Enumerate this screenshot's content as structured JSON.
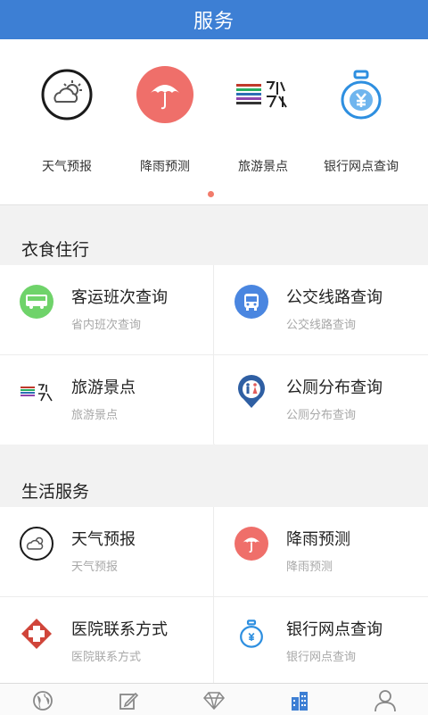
{
  "header": {
    "title": "服务"
  },
  "carousel": {
    "items": [
      {
        "label": "天气预报",
        "icon": "weather-icon"
      },
      {
        "label": "降雨预测",
        "icon": "umbrella-icon"
      },
      {
        "label": "旅游景点",
        "icon": "scenic-logo-icon"
      },
      {
        "label": "银行网点查询",
        "icon": "money-bag-icon"
      }
    ],
    "active_page": 1,
    "page_count": 1
  },
  "sections": [
    {
      "title": "衣食住行",
      "items": [
        {
          "title": "客运班次查询",
          "subtitle": "省内班次查询",
          "icon": "bus-icon"
        },
        {
          "title": "公交线路查询",
          "subtitle": "公交线路查询",
          "icon": "city-bus-icon"
        },
        {
          "title": "旅游景点",
          "subtitle": "旅游景点",
          "icon": "scenic-logo-icon"
        },
        {
          "title": "公厕分布查询",
          "subtitle": "公厕分布查询",
          "icon": "restroom-pin-icon"
        }
      ]
    },
    {
      "title": "生活服务",
      "items": [
        {
          "title": "天气预报",
          "subtitle": "天气预报",
          "icon": "weather-icon"
        },
        {
          "title": "降雨预测",
          "subtitle": "降雨预测",
          "icon": "umbrella-icon"
        },
        {
          "title": "医院联系方式",
          "subtitle": "医院联系方式",
          "icon": "hospital-cross-icon"
        },
        {
          "title": "银行网点查询",
          "subtitle": "银行网点查询",
          "icon": "money-bag-icon"
        }
      ]
    }
  ],
  "tabbar": {
    "tabs": [
      {
        "icon": "globe-icon"
      },
      {
        "icon": "edit-icon"
      },
      {
        "icon": "diamond-icon"
      },
      {
        "icon": "buildings-icon",
        "active": true
      },
      {
        "icon": "user-icon"
      }
    ]
  },
  "colors": {
    "header": "#3d7fd4",
    "accent": "#f27b6b",
    "active_tab": "#3d7fd4"
  }
}
